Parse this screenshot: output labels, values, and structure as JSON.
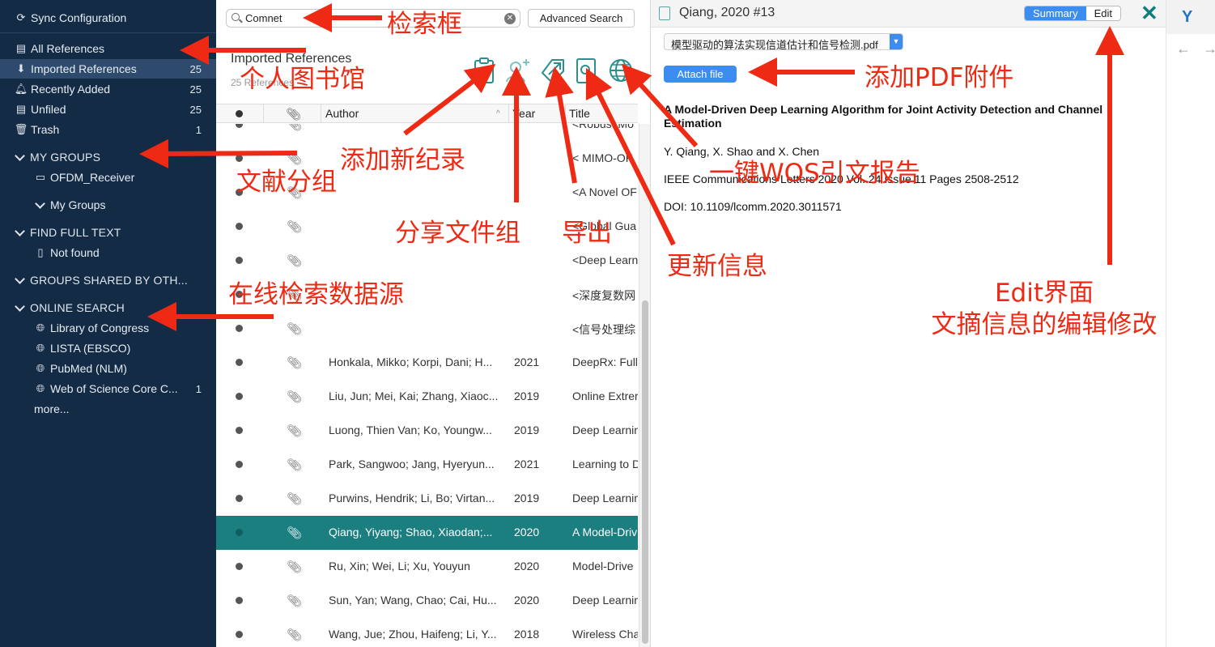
{
  "sidebar": {
    "sync": "Sync Configuration",
    "items": [
      {
        "label": "All References",
        "count": ""
      },
      {
        "label": "Imported References",
        "count": "25"
      },
      {
        "label": "Recently Added",
        "count": "25"
      },
      {
        "label": "Unfiled",
        "count": "25"
      },
      {
        "label": "Trash",
        "count": "1"
      }
    ],
    "my_groups_header": "MY GROUPS",
    "group_ofdm": "OFDM_Receiver",
    "my_groups_sub": "My Groups",
    "find_full_text_header": "FIND FULL TEXT",
    "not_found": "Not found",
    "groups_shared_header": "GROUPS SHARED BY OTH...",
    "online_search_header": "ONLINE SEARCH",
    "online": [
      {
        "label": "Library of Congress",
        "count": ""
      },
      {
        "label": "LISTA (EBSCO)",
        "count": ""
      },
      {
        "label": "PubMed (NLM)",
        "count": ""
      },
      {
        "label": "Web of Science Core C...",
        "count": "1"
      }
    ],
    "more": "more..."
  },
  "search": {
    "value": "Comnet",
    "advanced_label": "Advanced Search"
  },
  "group": {
    "title": "Imported References",
    "count": "25 References"
  },
  "columns": {
    "author": "Author",
    "year": "Year",
    "title": "Title"
  },
  "rows": [
    {
      "author": "",
      "year": "",
      "title": "<Robust Mo"
    },
    {
      "author": "",
      "year": "",
      "title": "< MIMO-OF"
    },
    {
      "author": "",
      "year": "",
      "title": "<A Novel OF"
    },
    {
      "author": "",
      "year": "",
      "title": "<Global Gua"
    },
    {
      "author": "",
      "year": "",
      "title": "<Deep Learn"
    },
    {
      "author": "",
      "year": "",
      "title": "<深度复数网"
    },
    {
      "author": "",
      "year": "",
      "title": "<信号处理综"
    },
    {
      "author": "Honkala, Mikko; Korpi, Dani; H...",
      "year": "2021",
      "title": "DeepRx: Full"
    },
    {
      "author": "Liu, Jun; Mei, Kai; Zhang, Xiaoc...",
      "year": "2019",
      "title": "Online Extrer"
    },
    {
      "author": "Luong, Thien Van; Ko, Youngw...",
      "year": "2019",
      "title": "Deep Learnin"
    },
    {
      "author": "Park, Sangwoo; Jang, Hyeryun...",
      "year": "2021",
      "title": "Learning to D"
    },
    {
      "author": "Purwins, Hendrik; Li, Bo; Virtan...",
      "year": "2019",
      "title": "Deep Learnin"
    },
    {
      "author": "Qiang, Yiyang; Shao, Xiaodan;...",
      "year": "2020",
      "title": "A Model-Driv"
    },
    {
      "author": "Ru, Xin; Wei, Li; Xu, Youyun",
      "year": "2020",
      "title": "Model-Drive"
    },
    {
      "author": "Sun, Yan; Wang, Chao; Cai, Hu...",
      "year": "2020",
      "title": "Deep Learnin"
    },
    {
      "author": "Wang, Jue; Zhou, Haifeng; Li, Y...",
      "year": "2018",
      "title": "Wireless Cha"
    }
  ],
  "detail": {
    "header_title": "Qiang, 2020 #13",
    "tab_summary": "Summary",
    "tab_edit": "Edit",
    "pdf_name": "模型驱动的算法实现信道估计和信号检测.pdf",
    "attach_label": "Attach file",
    "ref_title": "A Model-Driven Deep Learning Algorithm for Joint Activity Detection and Channel Estimation",
    "authors": "Y. Qiang, X. Shao and X. Chen",
    "journal": "IEEE Communications Letters 2020 Vol. 24 Issue 11 Pages 2508-2512",
    "doi": "DOI: 10.1109/lcomm.2020.3011571"
  },
  "annotations": {
    "search_box": "检索框",
    "personal_library": "个人图书馆",
    "doc_groups": "文献分组",
    "add_record": "添加新纪录",
    "share_group": "分享文件组",
    "export": "导出",
    "update_info": "更新信息",
    "wos_report": "一键WOS引文报告",
    "add_pdf": "添加PDF附件",
    "online_search": "在线检索数据源",
    "edit_line1": "Edit界面",
    "edit_line2": "文摘信息的编辑修改"
  },
  "colors": {
    "sidebar_bg": "#142b46",
    "selection_row": "#1b7e7f",
    "accent_blue": "#3d8cf0",
    "annotation_red": "#ee2a14"
  }
}
